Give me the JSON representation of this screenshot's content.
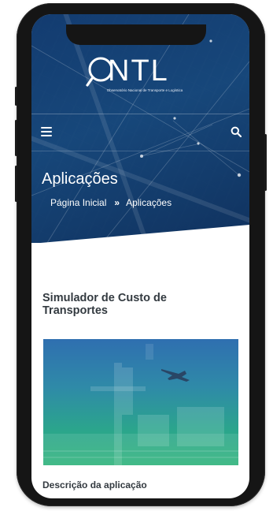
{
  "header": {
    "logo_text": "NTL",
    "logo_subtitle": "Observatório Nacional de Transporte e Logística"
  },
  "page": {
    "title": "Aplicações"
  },
  "breadcrumb": {
    "home": "Página Inicial",
    "separator": "»",
    "current": "Aplicações"
  },
  "content": {
    "section_title": "Simulador de Custo de Transportes",
    "next_heading": "Descrição da aplicação"
  },
  "icons": {
    "menu": "hamburger-menu-icon",
    "search": "search-icon"
  },
  "colors": {
    "hero": "#1b4c86",
    "heading_text": "#333a40",
    "image_top": "#2f6fb0",
    "image_bottom": "#2db27a"
  }
}
